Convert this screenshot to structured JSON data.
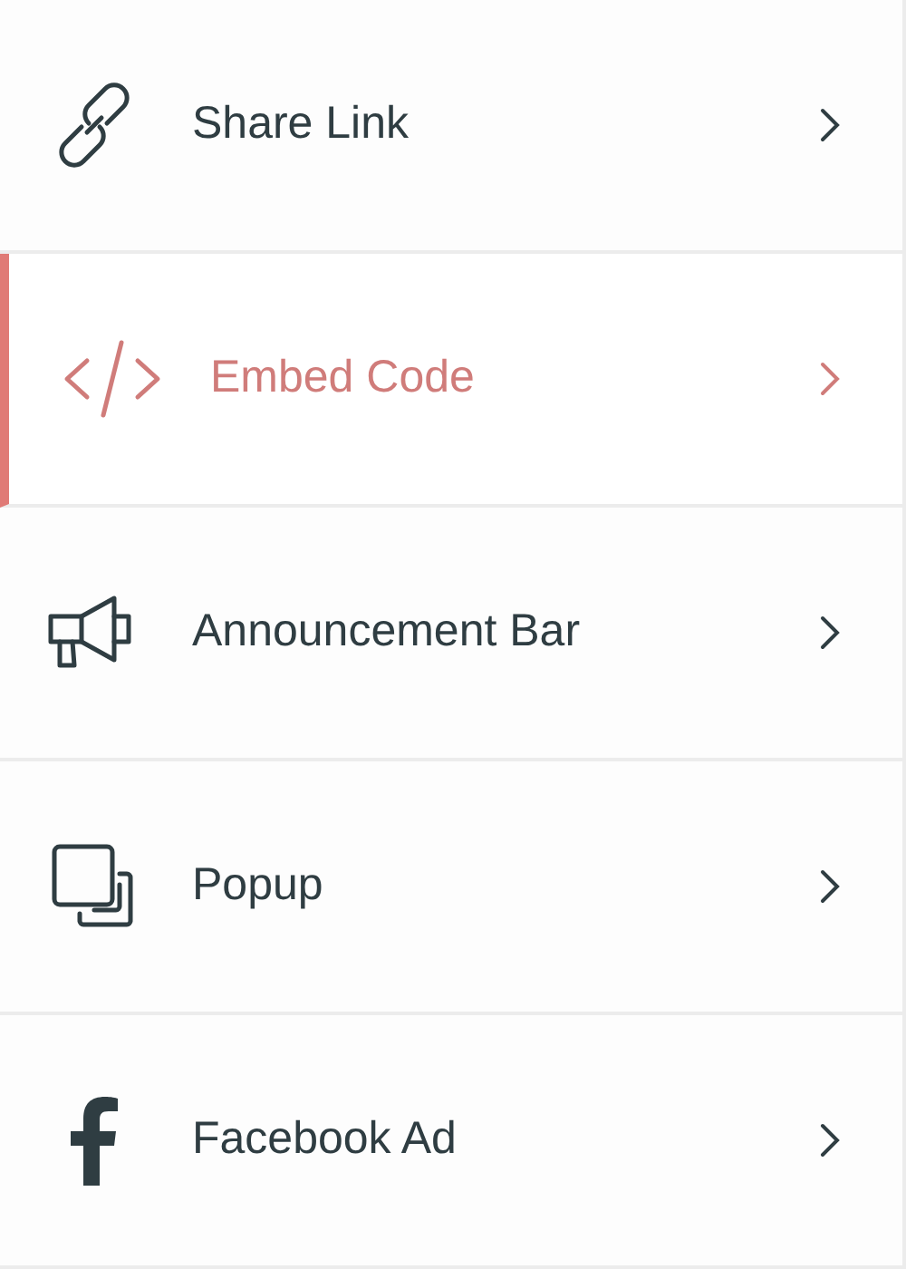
{
  "items": [
    {
      "label": "Share Link",
      "kind": "link",
      "selected": false
    },
    {
      "label": "Embed Code",
      "kind": "code",
      "selected": true
    },
    {
      "label": "Announcement Bar",
      "kind": "megaphone",
      "selected": false
    },
    {
      "label": "Popup",
      "kind": "popup",
      "selected": false
    },
    {
      "label": "Facebook Ad",
      "kind": "facebook",
      "selected": false
    }
  ]
}
